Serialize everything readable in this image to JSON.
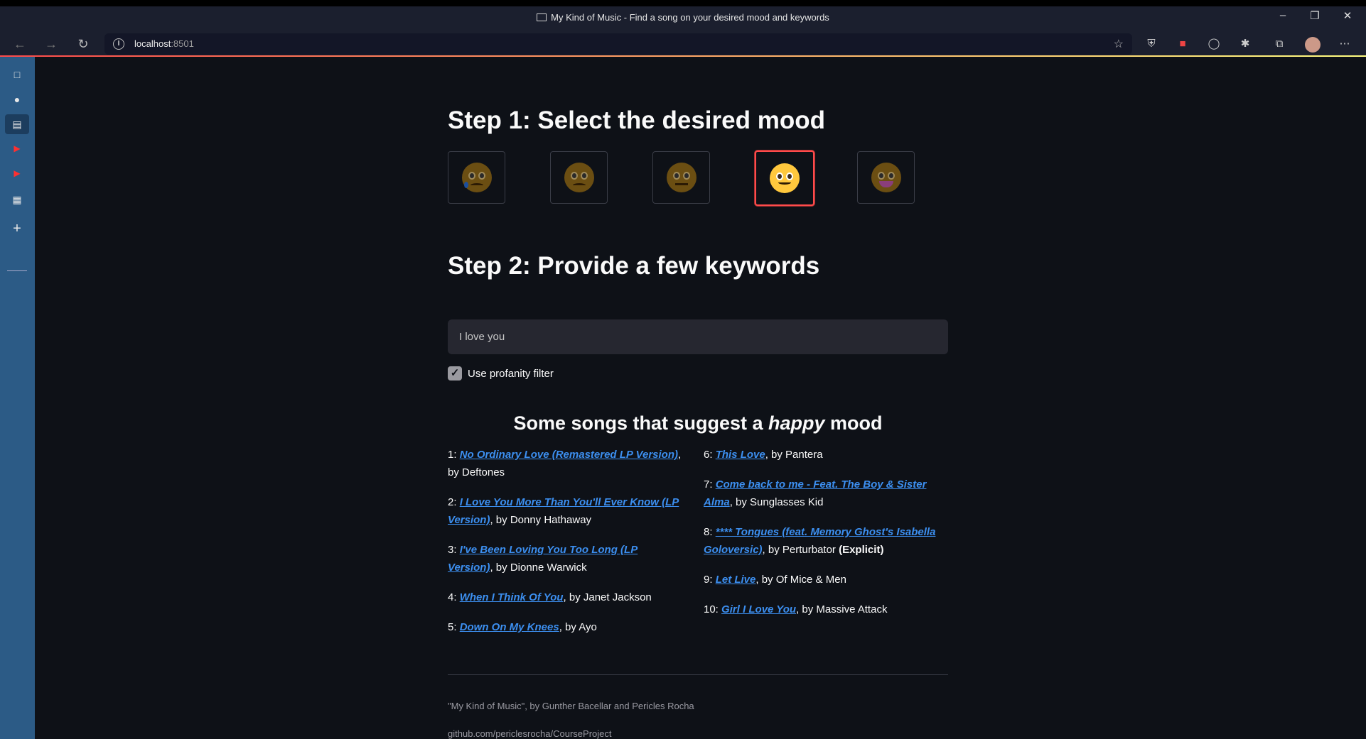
{
  "window": {
    "title": "My Kind of Music - Find a song on your desired mood and keywords",
    "minimize": "–",
    "restore": "❐",
    "close": "✕"
  },
  "browser": {
    "url_host": "localhost",
    "url_port": ":8501",
    "back": "←",
    "forward": "→",
    "reload": "↻",
    "more": "⋯",
    "info_glyph": "i",
    "star_glyph": "☆"
  },
  "sidebar": {
    "items": [
      {
        "icon": "tabs-icon",
        "glyph": "□"
      },
      {
        "icon": "github-icon",
        "glyph": "●"
      },
      {
        "icon": "reader-icon",
        "glyph": "▤"
      },
      {
        "icon": "youtube-icon",
        "glyph": "▶"
      },
      {
        "icon": "youtube-icon",
        "glyph": "▶"
      },
      {
        "icon": "calendar-icon",
        "glyph": "▦"
      },
      {
        "icon": "add-icon",
        "glyph": "+"
      }
    ]
  },
  "step1": {
    "title": "Step 1: Select the desired mood"
  },
  "moods": [
    {
      "name": "sad-tear",
      "selected": false
    },
    {
      "name": "frown",
      "selected": false
    },
    {
      "name": "neutral",
      "selected": false
    },
    {
      "name": "smile",
      "selected": true
    },
    {
      "name": "grin",
      "selected": false
    }
  ],
  "step2": {
    "title": "Step 2: Provide a few keywords"
  },
  "keywords": {
    "value": "I love you"
  },
  "profanity": {
    "label": "Use profanity filter",
    "checked": true,
    "check_glyph": "✓"
  },
  "results": {
    "title_prefix": "Some songs that suggest a ",
    "mood_word": "happy",
    "title_suffix": " mood",
    "songs_left": [
      {
        "num": "1: ",
        "title": "No Ordinary Love (Remastered LP Version)",
        "by": ", by Deftones"
      },
      {
        "num": "2: ",
        "title": "I Love You More Than You'll Ever Know (LP Version)",
        "by": ", by Donny Hathaway"
      },
      {
        "num": "3: ",
        "title": "I've Been Loving You Too Long (LP Version)",
        "by": ", by Dionne Warwick"
      },
      {
        "num": "4: ",
        "title": "When I Think Of You",
        "by": ", by Janet Jackson"
      },
      {
        "num": "5: ",
        "title": "Down On My Knees",
        "by": ", by Ayo"
      }
    ],
    "songs_right": [
      {
        "num": "6: ",
        "title": "This Love",
        "by": ", by Pantera"
      },
      {
        "num": "7: ",
        "title": "Come back to me - Feat. The Boy & Sister Alma",
        "by": ", by Sunglasses Kid"
      },
      {
        "num": "8: ",
        "title": "**** Tongues (feat. Memory Ghost's Isabella Goloversic)",
        "by": ", by Perturbator ",
        "extra": "(Explicit)"
      },
      {
        "num": "9: ",
        "title": "Let Live",
        "by": ", by Of Mice & Men"
      },
      {
        "num": "10: ",
        "title": "Girl I Love You",
        "by": ", by Massive Attack"
      }
    ]
  },
  "footer": {
    "credit": "\"My Kind of Music\", by Gunther Bacellar and Pericles Rocha",
    "repo": "github.com/periclesrocha/CourseProject"
  },
  "colors": {
    "accent": "#ff4b4b",
    "link": "#3c8ff0",
    "background": "#0e1117",
    "sidebar": "#2c5b86"
  }
}
